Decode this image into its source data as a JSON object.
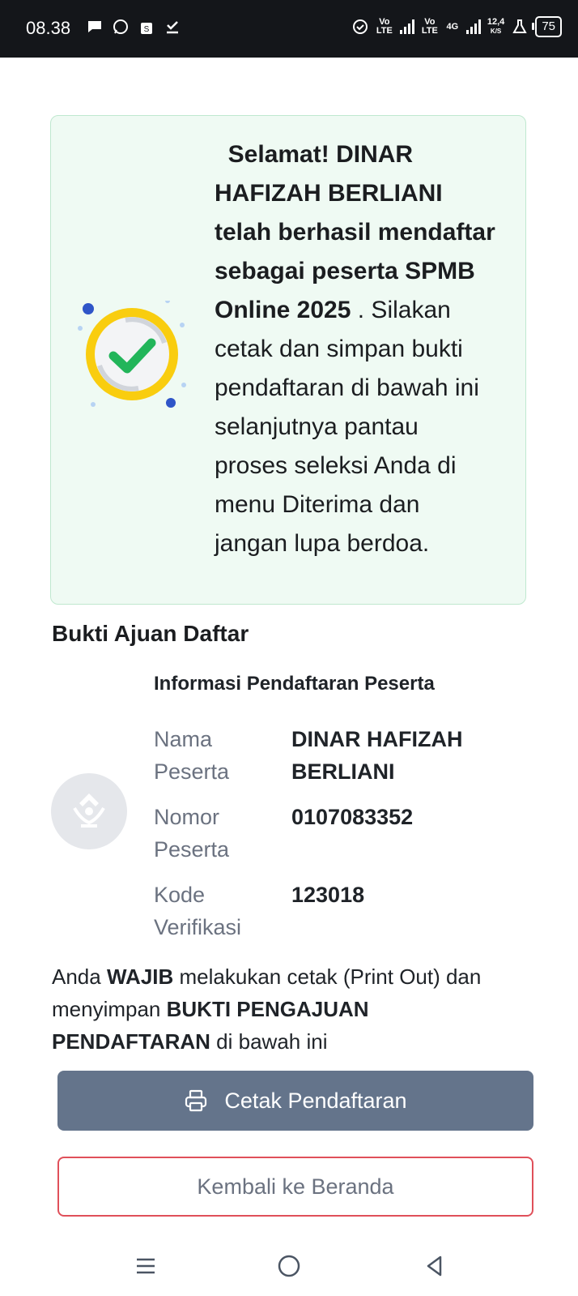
{
  "status_bar": {
    "time": "08.38",
    "network_speed": "12,4",
    "network_speed_unit": "K/S",
    "battery": "75",
    "net1": "Vo LTE",
    "net2": "Vo LTE",
    "net3": "4G"
  },
  "success": {
    "greeting": "Selamat!",
    "name": "DINAR HAFIZAH BERLIANI",
    "text_bold": "telah berhasil mendaftar sebagai peserta SPMB Online 2025",
    "text_rest": ". Silakan cetak dan simpan bukti pendaftaran di bawah ini selanjutnya pantau proses seleksi Anda di menu Diterima dan jangan lupa berdoa."
  },
  "proof": {
    "section_title": "Bukti Ajuan Daftar",
    "info_title": "Informasi Pendaftaran Peserta",
    "rows": [
      {
        "label": "Nama Peserta",
        "value": "DINAR HAFIZAH BERLIANI"
      },
      {
        "label": "Nomor Peserta",
        "value": "0107083352"
      },
      {
        "label": "Kode Verifikasi",
        "value": "123018"
      }
    ]
  },
  "notice": {
    "part1": "Anda ",
    "wajib": "WAJIB",
    "part2": " melakukan cetak (Print Out) dan menyimpan ",
    "bukti": "BUKTI PENGAJUAN PENDAFTARAN",
    "part3": " di bawah ini"
  },
  "buttons": {
    "print_label": "Cetak Pendaftaran",
    "back_label": "Kembali ke Beranda"
  },
  "colors": {
    "success_bg": "#effaf3",
    "print_button": "#64748b",
    "back_border": "#e0505a",
    "check_green": "#22b55a",
    "ring_yellow": "#f9cd0f"
  },
  "icons": {
    "success": "check-circle-icon",
    "print": "printer-icon",
    "avatar": "tut-wuri-handayani-logo"
  }
}
